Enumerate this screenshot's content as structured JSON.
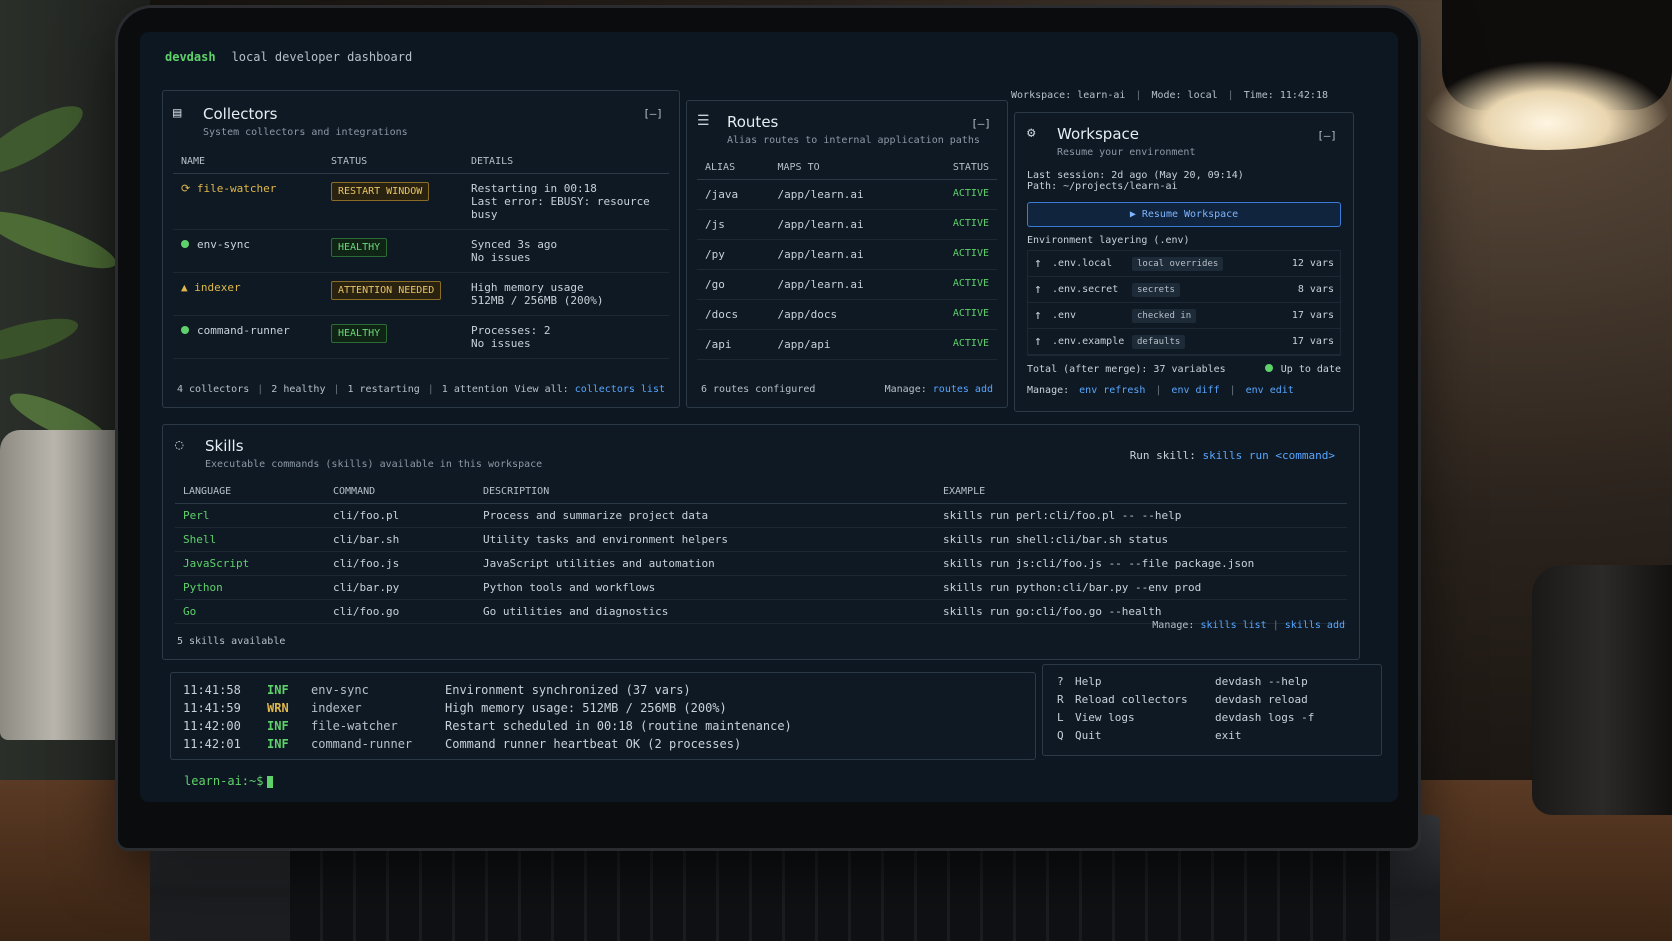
{
  "app": {
    "name": "devdash",
    "subtitle": "local developer dashboard"
  },
  "status": {
    "workspace": "Workspace: learn-ai",
    "mode": "Mode: local",
    "time": "Time: 11:42:18"
  },
  "collectors": {
    "title": "Collectors",
    "subtitle": "System collectors and integrations",
    "collapse": "[–]",
    "columns": [
      "NAME",
      "STATUS",
      "DETAILS"
    ],
    "rows": [
      {
        "name": "file-watcher",
        "status": "RESTART WINDOW",
        "detail1": "Restarting in 00:18",
        "detail2": "Last error: EBUSY: resource busy"
      },
      {
        "name": "env-sync",
        "status": "HEALTHY",
        "detail1": "Synced 3s ago",
        "detail2": "No issues"
      },
      {
        "name": "indexer",
        "status": "ATTENTION NEEDED",
        "detail1": "High memory usage",
        "detail2": "512MB / 256MB (200%)"
      },
      {
        "name": "command-runner",
        "status": "HEALTHY",
        "detail1": "Processes: 2",
        "detail2": "No issues"
      }
    ],
    "footer": {
      "count": "4 collectors",
      "healthy": "2 healthy",
      "restarting": "1 restarting",
      "attention": "1 attention",
      "view_label": "View all:",
      "view_link": "collectors list"
    }
  },
  "routes": {
    "title": "Routes",
    "subtitle": "Alias routes to internal application paths",
    "collapse": "[–]",
    "columns": [
      "ALIAS",
      "MAPS TO",
      "STATUS"
    ],
    "rows": [
      {
        "alias": "/java",
        "maps": "/app/learn.ai",
        "status": "ACTIVE"
      },
      {
        "alias": "/js",
        "maps": "/app/learn.ai",
        "status": "ACTIVE"
      },
      {
        "alias": "/py",
        "maps": "/app/learn.ai",
        "status": "ACTIVE"
      },
      {
        "alias": "/go",
        "maps": "/app/learn.ai",
        "status": "ACTIVE"
      },
      {
        "alias": "/docs",
        "maps": "/app/docs",
        "status": "ACTIVE"
      },
      {
        "alias": "/api",
        "maps": "/app/api",
        "status": "ACTIVE"
      }
    ],
    "footer": {
      "count": "6 routes configured",
      "manage_label": "Manage:",
      "manage_link": "routes add"
    }
  },
  "workspace": {
    "title": "Workspace",
    "subtitle": "Resume your environment",
    "collapse": "[–]",
    "last_session": "Last session: 2d ago (May 20, 09:14)",
    "path": "Path: ~/projects/learn-ai",
    "resume_button": "Resume Workspace",
    "layering_title": "Environment layering (.env)",
    "env": [
      {
        "name": ".env.local",
        "tag": "local overrides",
        "count": "12 vars"
      },
      {
        "name": ".env.secret",
        "tag": "secrets",
        "count": "8 vars"
      },
      {
        "name": ".env",
        "tag": "checked in",
        "count": "17 vars"
      },
      {
        "name": ".env.example",
        "tag": "defaults",
        "count": "17 vars"
      }
    ],
    "total": "Total (after merge): 37 variables",
    "uptodate": "Up to date",
    "manage_label": "Manage:",
    "manage_links": [
      "env refresh",
      "env diff",
      "env edit"
    ]
  },
  "skills": {
    "title": "Skills",
    "subtitle": "Executable commands (skills) available in this workspace",
    "run_label": "Run skill:",
    "run_link": "skills run <command>",
    "columns": [
      "LANGUAGE",
      "COMMAND",
      "DESCRIPTION",
      "EXAMPLE"
    ],
    "rows": [
      {
        "lang": "Perl",
        "cmd": "cli/foo.pl",
        "desc": "Process and summarize project data",
        "example": "skills run perl:cli/foo.pl -- --help"
      },
      {
        "lang": "Shell",
        "cmd": "cli/bar.sh",
        "desc": "Utility tasks and environment helpers",
        "example": "skills run shell:cli/bar.sh status"
      },
      {
        "lang": "JavaScript",
        "cmd": "cli/foo.js",
        "desc": "JavaScript utilities and automation",
        "example": "skills run js:cli/foo.js -- --file package.json"
      },
      {
        "lang": "Python",
        "cmd": "cli/bar.py",
        "desc": "Python tools and workflows",
        "example": "skills run python:cli/bar.py --env prod"
      },
      {
        "lang": "Go",
        "cmd": "cli/foo.go",
        "desc": "Go utilities and diagnostics",
        "example": "skills run go:cli/foo.go --health"
      }
    ],
    "count": "5 skills available",
    "manage_label": "Manage:",
    "manage_links": [
      "skills list",
      "skills add"
    ]
  },
  "logs": [
    {
      "ts": "11:41:58",
      "lvl": "INF",
      "src": "env-sync",
      "msg": "Environment synchronized (37 vars)"
    },
    {
      "ts": "11:41:59",
      "lvl": "WRN",
      "src": "indexer",
      "msg": "High memory usage: 512MB / 256MB (200%)"
    },
    {
      "ts": "11:42:00",
      "lvl": "INF",
      "src": "file-watcher",
      "msg": "Restart scheduled in 00:18 (routine maintenance)"
    },
    {
      "ts": "11:42:01",
      "lvl": "INF",
      "src": "command-runner",
      "msg": "Command runner heartbeat OK (2 processes)"
    }
  ],
  "help": [
    {
      "key": "?",
      "label": "Help",
      "cmd": "devdash --help"
    },
    {
      "key": "R",
      "label": "Reload collectors",
      "cmd": "devdash reload"
    },
    {
      "key": "L",
      "label": "View logs",
      "cmd": "devdash logs -f"
    },
    {
      "key": "Q",
      "label": "Quit",
      "cmd": "exit"
    }
  ],
  "prompt": "learn-ai:~$",
  "colors": {
    "accent_green": "#5fd16a",
    "warn_yellow": "#e0b84a",
    "link_blue": "#58a6ff",
    "bg": "#0d1722"
  }
}
